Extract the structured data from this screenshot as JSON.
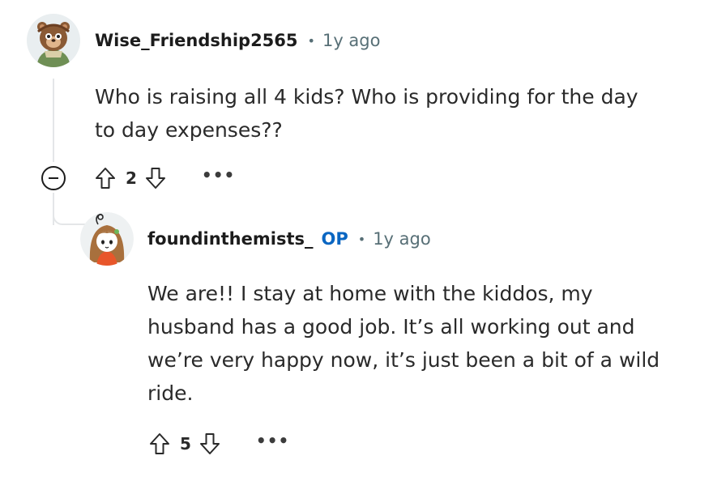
{
  "comments": [
    {
      "author": "Wise_Friendship2565",
      "separator": "•",
      "time": "1y ago",
      "body_lines": [
        "Who is raising all 4 kids? Who is providing for the day",
        "to day expenses??"
      ],
      "score": "2",
      "more": "•••",
      "avatar_icon": "bear-avatar-icon"
    },
    {
      "author": "foundinthemists_",
      "badge": "OP",
      "separator": "•",
      "time": "1y ago",
      "body_lines": [
        "We are!! I stay at home with the kiddos, my",
        "husband has a good job. It’s all working out and",
        "we’re very happy now, it’s just been a bit of a wild",
        "ride."
      ],
      "score": "5",
      "more": "•••",
      "avatar_icon": "girl-avatar-icon"
    }
  ],
  "colors": {
    "op_badge": "#0a66c2",
    "meta_text": "#576f76",
    "thread_line": "#e4e6e8"
  }
}
